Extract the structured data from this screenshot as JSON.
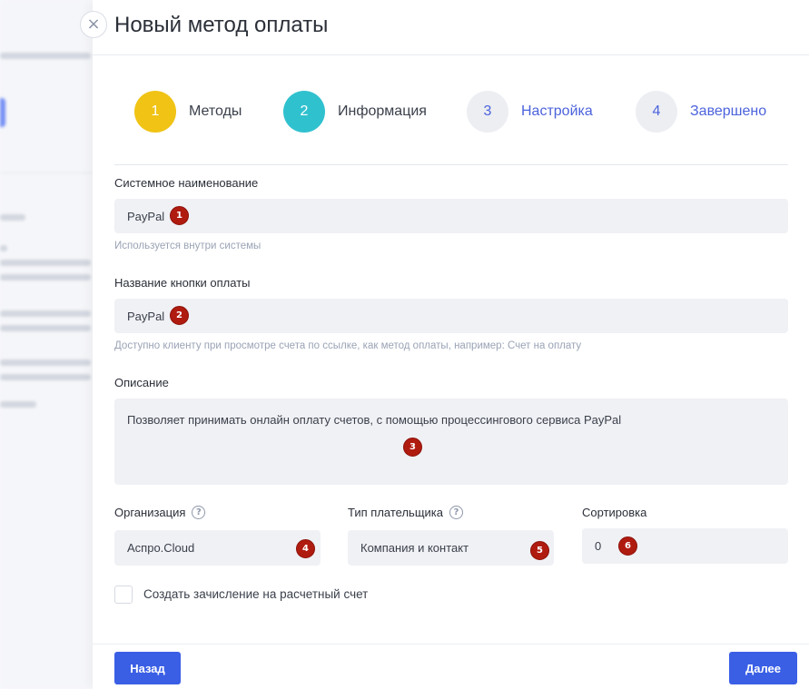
{
  "modal": {
    "title": "Новый метод оплаты",
    "close_icon": "×"
  },
  "stepper": {
    "steps": [
      {
        "number": "1",
        "label": "Методы",
        "state": "done",
        "color": "#f0c315"
      },
      {
        "number": "2",
        "label": "Информация",
        "state": "active",
        "color": "#30c1cf"
      },
      {
        "number": "3",
        "label": "Настройка",
        "state": "pending",
        "color": "#eceef2"
      },
      {
        "number": "4",
        "label": "Завершено",
        "state": "pending",
        "color": "#eceef2"
      }
    ]
  },
  "form": {
    "system_name": {
      "label": "Системное наименование",
      "value": "PayPal",
      "hint": "Используется внутри системы",
      "badge": "1"
    },
    "button_name": {
      "label": "Название кнопки оплаты",
      "value": "PayPal",
      "hint": "Доступно клиенту при просмотре счета по ссылке, как метод оплаты, например: Счет на оплату",
      "badge": "2"
    },
    "description": {
      "label": "Описание",
      "value": "Позволяет принимать онлайн оплату счетов, с помощью процессингового сервиса PayPal",
      "badge": "3"
    },
    "organization": {
      "label": "Организация",
      "help_icon": "?",
      "value": "Аспро.Cloud",
      "badge": "4"
    },
    "payer_type": {
      "label": "Тип плательщика",
      "help_icon": "?",
      "value": "Компания и контакт",
      "badge": "5"
    },
    "sorting": {
      "label": "Сортировка",
      "value": "0",
      "badge": "6"
    },
    "create_deposit": {
      "label": "Создать зачисление на расчетный счет",
      "checked": false
    }
  },
  "footer": {
    "back_label": "Назад",
    "next_label": "Далее"
  },
  "colors": {
    "primary": "#3a5fe5",
    "badge": "#b01b10",
    "field_bg": "#f0f1f5"
  }
}
